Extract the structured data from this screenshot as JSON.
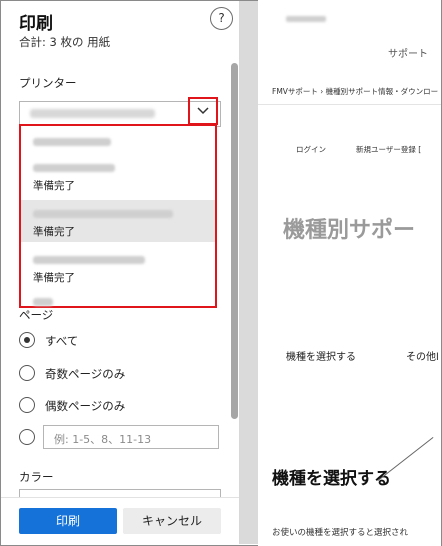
{
  "panel": {
    "title": "印刷",
    "subtitle": "合計: 3 枚の 用紙",
    "help_icon": "?"
  },
  "printer": {
    "label": "プリンター",
    "dropdown_items": [
      {
        "status": ""
      },
      {
        "status": "準備完了"
      },
      {
        "status": "準備完了"
      },
      {
        "status": "準備完了"
      }
    ]
  },
  "pages": {
    "label": "ページ",
    "options": [
      "すべて",
      "奇数ページのみ",
      "偶数ページのみ"
    ],
    "selected": "すべて",
    "custom_placeholder": "例: 1-5、8、11-13"
  },
  "color": {
    "label": "カラー"
  },
  "buttons": {
    "print": "印刷",
    "cancel": "キャンセル"
  },
  "preview": {
    "support": "サポート",
    "breadcrumb": "FMVサポート › 機種別サポート情報・ダウンロー",
    "login": "ログイン",
    "register": "新規ユーザー登録 [",
    "big_title": "機種別サポー",
    "select_model": "機種を選択する",
    "other": "その他l",
    "heading": "機種を選択する",
    "body": "お使いの機種を選択すると選択され"
  },
  "colors": {
    "accent": "#1572d9",
    "highlight": "#e0151b"
  }
}
